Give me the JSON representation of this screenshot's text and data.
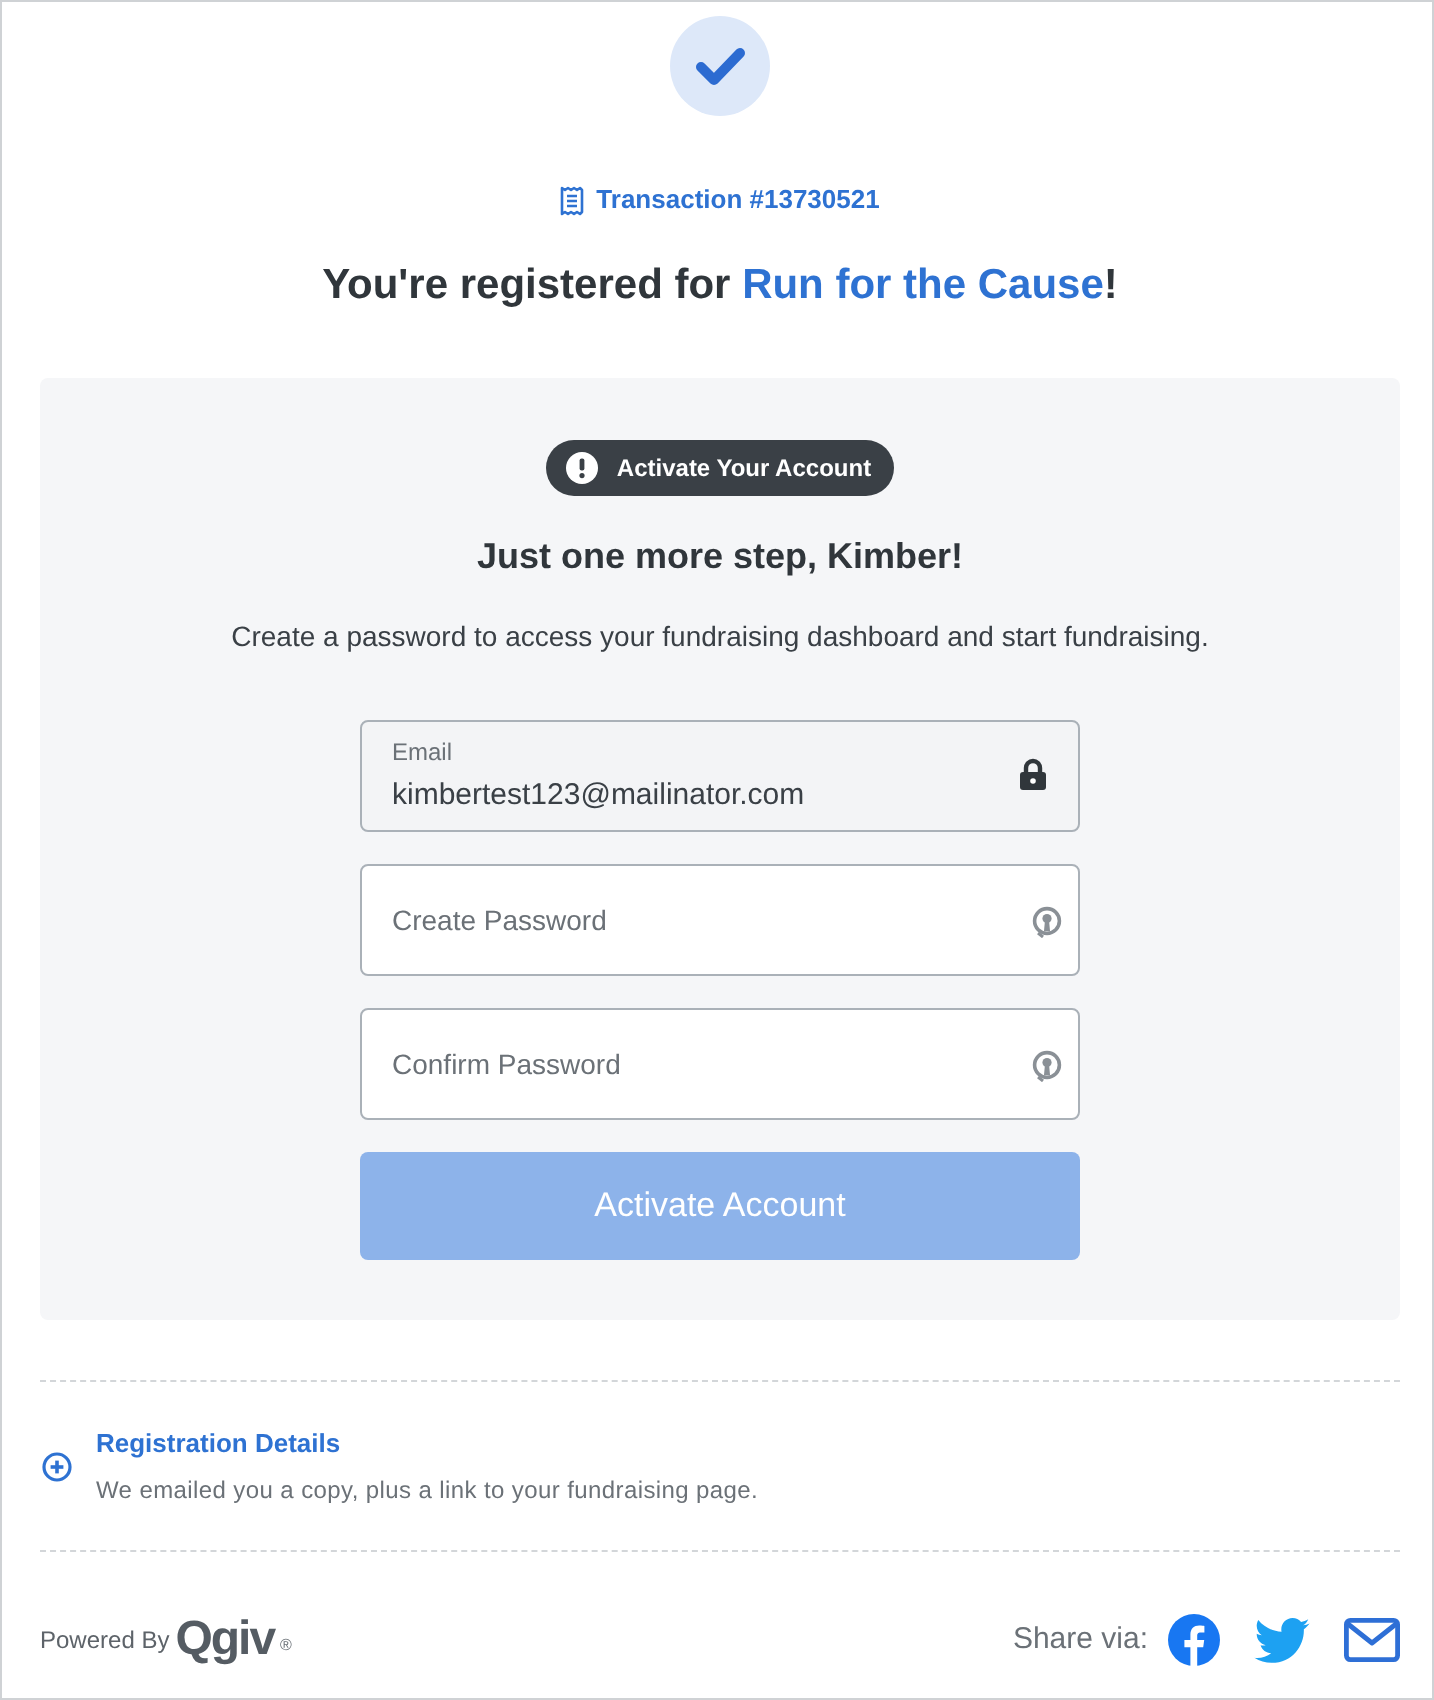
{
  "confirmation": {
    "transaction": "Transaction #13730521",
    "heading": {
      "prefix": "You're registered for ",
      "event": "Run for the Cause",
      "suffix": "!"
    }
  },
  "activation": {
    "badge": "Activate Your Account",
    "title": "Just one more step, Kimber!",
    "description": "Create a password to access your fundraising dashboard and start fundraising.",
    "fields": [
      {
        "kind": "locked",
        "label": "Email",
        "value": "kimbertest123@mailinator.com"
      },
      {
        "kind": "password",
        "placeholder": "Create Password"
      },
      {
        "kind": "password",
        "placeholder": "Confirm Password"
      }
    ],
    "button": {
      "label": "Activate Account",
      "disabled": true
    }
  },
  "registration_details": {
    "title": "Registration Details",
    "note": "We emailed you a copy, plus a link to your fundraising page.",
    "expanded": false
  },
  "footer": {
    "powered_by": "Powered By",
    "logo": "Qgiv",
    "logo_mark": "®",
    "share_label": "Share via:",
    "share_targets": [
      {
        "kind": "facebook"
      },
      {
        "kind": "twitter"
      },
      {
        "kind": "email"
      }
    ]
  }
}
